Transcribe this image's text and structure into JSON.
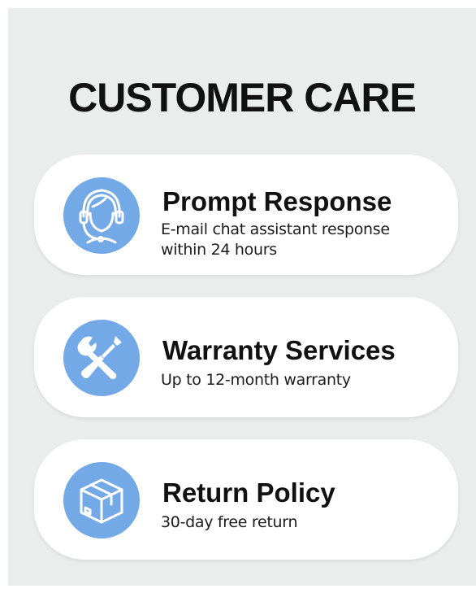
{
  "title": "CUSTOMER CARE",
  "accent_color": "#74a9e8",
  "cards": [
    {
      "icon": "headset-agent-icon",
      "heading": "Prompt Response",
      "description": "E-mail chat assistant response within 24 hours"
    },
    {
      "icon": "wrench-screwdriver-icon",
      "heading": "Warranty Services",
      "description": "Up to 12-month warranty"
    },
    {
      "icon": "package-box-icon",
      "heading": "Return Policy",
      "description": "30-day free return"
    }
  ]
}
